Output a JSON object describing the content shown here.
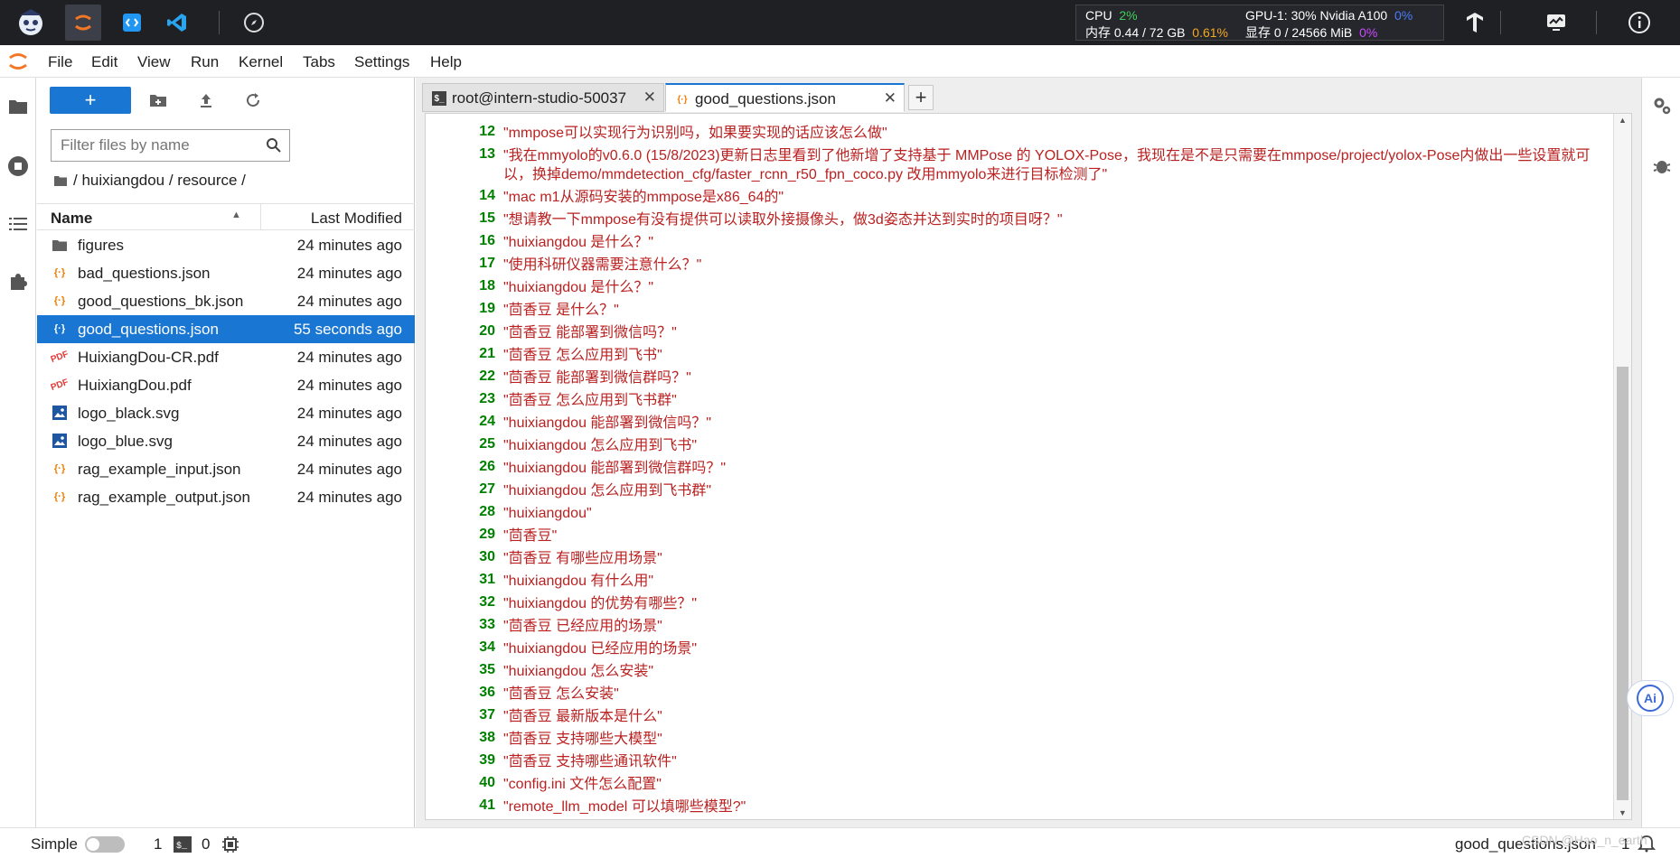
{
  "topbar": {
    "metrics": {
      "cpu_label": "CPU",
      "cpu_value": "2%",
      "mem_label": "内存 0.44 / 72 GB",
      "mem_value": "0.61%",
      "gpu_label": "GPU-1: 30% Nvidia A100",
      "gpu_value": "0%",
      "vram_label": "显存 0 / 24566 MiB",
      "vram_value": "0%"
    },
    "icons": [
      "mascot-logo",
      "jupyter-icon",
      "code-icon",
      "vscode-icon",
      "compass-icon",
      "tensorflow-icon",
      "monitor-icon",
      "info-icon"
    ]
  },
  "menu": {
    "items": [
      "File",
      "Edit",
      "View",
      "Run",
      "Kernel",
      "Tabs",
      "Settings",
      "Help"
    ]
  },
  "filebrowser": {
    "new_label": "+",
    "filter_placeholder": "Filter files by name",
    "breadcrumb": "/ huixiangdou / resource /",
    "col_name": "Name",
    "col_modified": "Last Modified",
    "files": [
      {
        "name": "figures",
        "time": "24 minutes ago",
        "icon": "folder-icon"
      },
      {
        "name": "bad_questions.json",
        "time": "24 minutes ago",
        "icon": "json-icon"
      },
      {
        "name": "good_questions_bk.json",
        "time": "24 minutes ago",
        "icon": "json-icon"
      },
      {
        "name": "good_questions.json",
        "time": "55 seconds ago",
        "icon": "json-icon"
      },
      {
        "name": "HuixiangDou-CR.pdf",
        "time": "24 minutes ago",
        "icon": "pdf-icon"
      },
      {
        "name": "HuixiangDou.pdf",
        "time": "24 minutes ago",
        "icon": "pdf-icon"
      },
      {
        "name": "logo_black.svg",
        "time": "24 minutes ago",
        "icon": "image-icon"
      },
      {
        "name": "logo_blue.svg",
        "time": "24 minutes ago",
        "icon": "image-icon"
      },
      {
        "name": "rag_example_input.json",
        "time": "24 minutes ago",
        "icon": "json-icon"
      },
      {
        "name": "rag_example_output.json",
        "time": "24 minutes ago",
        "icon": "json-icon"
      }
    ],
    "selected_index": 3
  },
  "tabs": [
    {
      "label": "root@intern-studio-50037",
      "icon": "terminal-icon",
      "active": false
    },
    {
      "label": "good_questions.json",
      "icon": "json-icon",
      "active": true
    }
  ],
  "editor": {
    "lines": [
      {
        "n": "12",
        "text": "\"mmpose可以实现行为识别吗，如果要实现的话应该怎么做\""
      },
      {
        "n": "13",
        "text": "\"我在mmyolo的v0.6.0 (15/8/2023)更新日志里看到了他新增了支持基于 MMPose 的 YOLOX-Pose，我现在是不是只需要在mmpose/project/yolox-Pose内做出一些设置就可以，换掉demo/mmdetection_cfg/faster_rcnn_r50_fpn_coco.py 改用mmyolo来进行目标检测了\""
      },
      {
        "n": "14",
        "text": "\"mac m1从源码安装的mmpose是x86_64的\""
      },
      {
        "n": "15",
        "text": "\"想请教一下mmpose有没有提供可以读取外接摄像头，做3d姿态并达到实时的项目呀？\""
      },
      {
        "n": "16",
        "text": "\"huixiangdou 是什么？\""
      },
      {
        "n": "17",
        "text": "\"使用科研仪器需要注意什么？\""
      },
      {
        "n": "18",
        "text": "\"huixiangdou 是什么？\""
      },
      {
        "n": "19",
        "text": "\"茴香豆 是什么？\""
      },
      {
        "n": "20",
        "text": "\"茴香豆 能部署到微信吗？\""
      },
      {
        "n": "21",
        "text": "\"茴香豆 怎么应用到飞书\""
      },
      {
        "n": "22",
        "text": "\"茴香豆 能部署到微信群吗？\""
      },
      {
        "n": "23",
        "text": "\"茴香豆 怎么应用到飞书群\""
      },
      {
        "n": "24",
        "text": "\"huixiangdou 能部署到微信吗？\""
      },
      {
        "n": "25",
        "text": "\"huixiangdou 怎么应用到飞书\""
      },
      {
        "n": "26",
        "text": "\"huixiangdou 能部署到微信群吗？\""
      },
      {
        "n": "27",
        "text": "\"huixiangdou 怎么应用到飞书群\""
      },
      {
        "n": "28",
        "text": "\"huixiangdou\""
      },
      {
        "n": "29",
        "text": "\"茴香豆\""
      },
      {
        "n": "30",
        "text": "\"茴香豆 有哪些应用场景\""
      },
      {
        "n": "31",
        "text": "\"huixiangdou 有什么用\""
      },
      {
        "n": "32",
        "text": "\"huixiangdou 的优势有哪些？\""
      },
      {
        "n": "33",
        "text": "\"茴香豆 已经应用的场景\""
      },
      {
        "n": "34",
        "text": "\"huixiangdou 已经应用的场景\""
      },
      {
        "n": "35",
        "text": "\"huixiangdou 怎么安装\""
      },
      {
        "n": "36",
        "text": "\"茴香豆 怎么安装\""
      },
      {
        "n": "37",
        "text": "\"茴香豆 最新版本是什么\""
      },
      {
        "n": "38",
        "text": "\"茴香豆 支持哪些大模型\""
      },
      {
        "n": "39",
        "text": "\"茴香豆 支持哪些通讯软件\""
      },
      {
        "n": "40",
        "text": "\"config.ini 文件怎么配置\""
      },
      {
        "n": "41",
        "text": "\"remote_llm_model 可以填哪些模型?\""
      }
    ]
  },
  "statusbar": {
    "mode_label": "Simple",
    "count_a": "1",
    "count_b": "0",
    "current_file": "good_questions.json",
    "position": "1"
  },
  "watermark": "CSDN @Hao_n_earth",
  "colors": {
    "accent": "#1976d2",
    "string": "#ba2121",
    "line_number": "#008000",
    "topbar": "#1f2024"
  }
}
